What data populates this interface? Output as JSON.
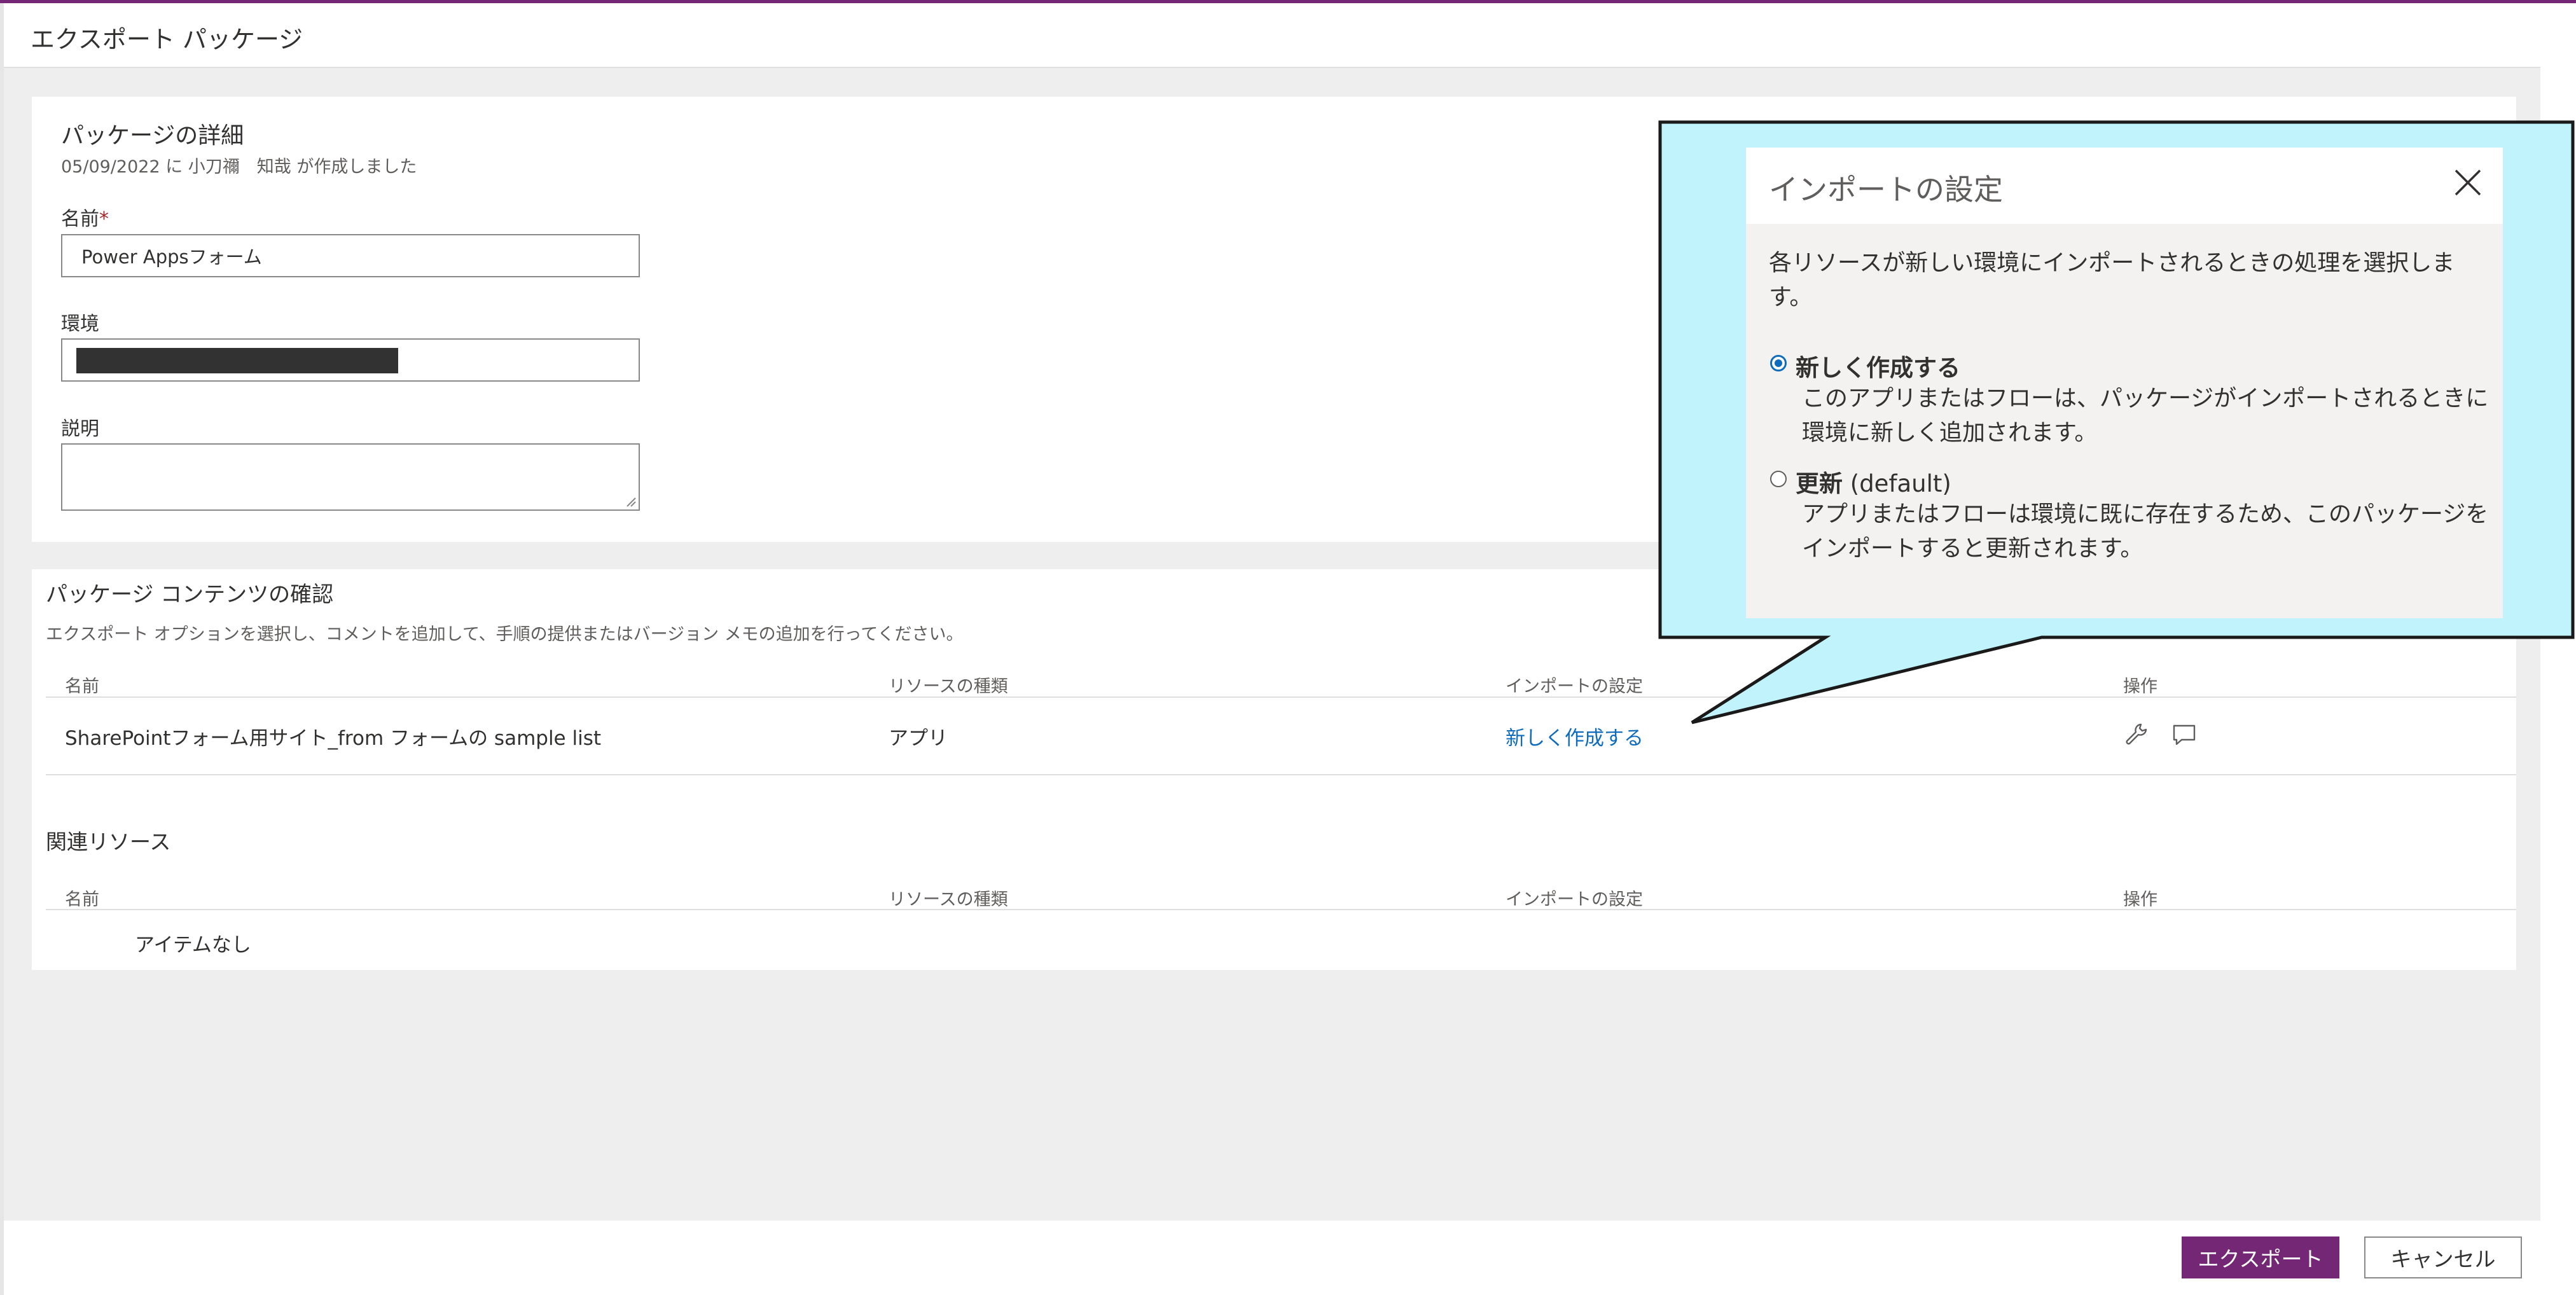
{
  "header": {
    "title": "エクスポート パッケージ"
  },
  "details": {
    "title": "パッケージの詳細",
    "created_info": "05/09/2022 に 小刀禰　知哉 が作成しました",
    "name_label": "名前",
    "required_mark": "*",
    "name_value": "Power Appsフォーム",
    "environment_label": "環境",
    "description_label": "説明",
    "description_value": ""
  },
  "contents": {
    "title": "パッケージ コンテンツの確認",
    "subtitle": "エクスポート オプションを選択し、コメントを追加して、手順の提供またはバージョン メモの追加を行ってください。",
    "columns": [
      "名前",
      "リソースの種類",
      "インポートの設定",
      "操作"
    ],
    "rows": [
      {
        "name": "SharePointフォーム用サイト_from フォームの sample list",
        "type": "アプリ",
        "import_setting": "新しく作成する"
      }
    ],
    "actions": [
      "wrench-icon",
      "comment-icon"
    ]
  },
  "related": {
    "title": "関連リソース",
    "columns": [
      "名前",
      "リソースの種類",
      "インポートの設定",
      "操作"
    ],
    "empty_text": "アイテムなし"
  },
  "footer": {
    "export_label": "エクスポート",
    "cancel_label": "キャンセル"
  },
  "import_popup": {
    "title": "インポートの設定",
    "description": "各リソースが新しい環境にインポートされるときの処理を選択します。",
    "options": [
      {
        "label": "新しく作成する",
        "suffix": "",
        "selected": true,
        "description": "このアプリまたはフローは、パッケージがインポートされるときに環境に新しく追加されます。"
      },
      {
        "label": "更新",
        "suffix": " (default)",
        "selected": false,
        "description": "アプリまたはフローは環境に既に存在するため、このパッケージをインポートすると更新されます。"
      }
    ]
  },
  "colors": {
    "accent": "#742774",
    "link": "#0f6cbd",
    "callout_fill": "#c0f3fb",
    "callout_border": "#1a1a1a"
  }
}
